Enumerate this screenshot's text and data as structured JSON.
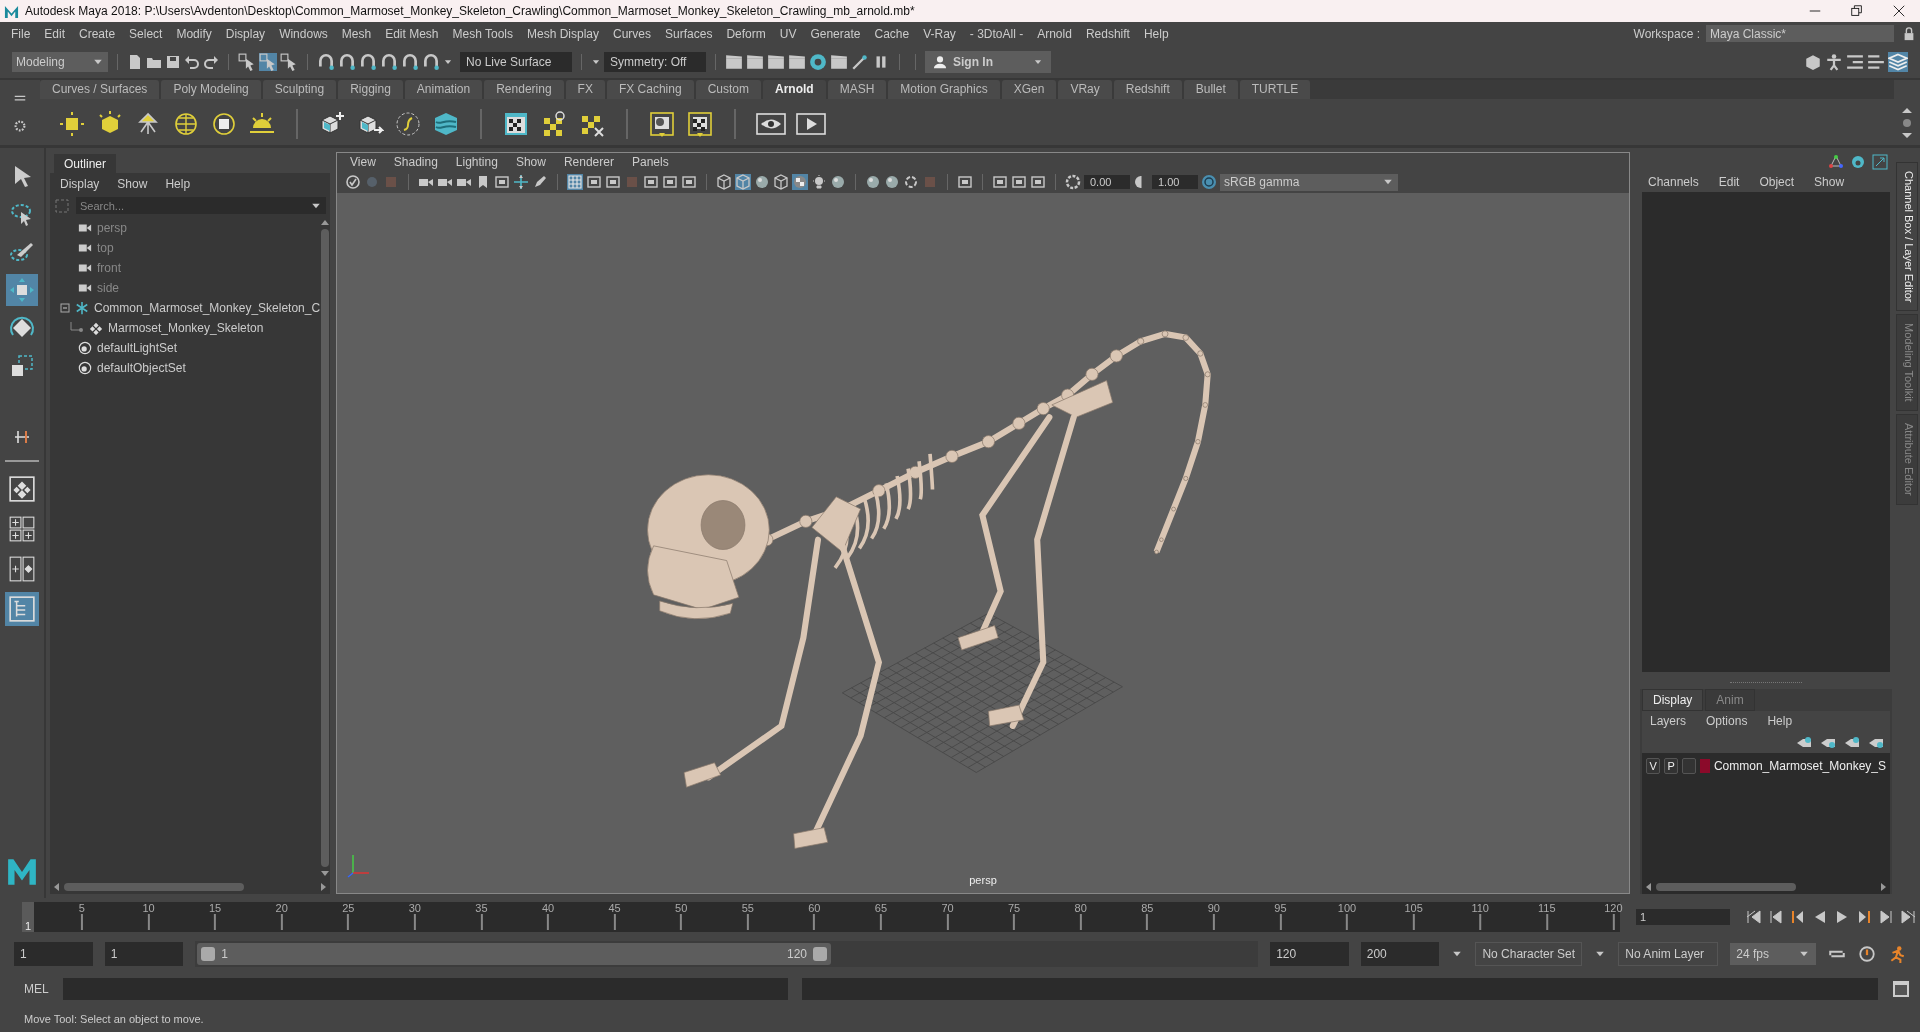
{
  "window": {
    "title": "Autodesk Maya 2018: P:\\Users\\Avdenton\\Desktop\\Common_Marmoset_Monkey_Skeleton_Crawling\\Common_Marmoset_Monkey_Skeleton_Crawling_mb_arnold.mb*"
  },
  "menu_bar": [
    "File",
    "Edit",
    "Create",
    "Select",
    "Modify",
    "Display",
    "Windows",
    "Mesh",
    "Edit Mesh",
    "Mesh Tools",
    "Mesh Display",
    "Curves",
    "Surfaces",
    "Deform",
    "UV",
    "Generate",
    "Cache",
    "V-Ray",
    "- 3DtoAll -",
    "Arnold",
    "Redshift",
    "Help"
  ],
  "workspace": {
    "label": "Workspace :",
    "value": "Maya Classic*"
  },
  "status_line": {
    "mode": "Modeling",
    "selection_masks": [
      {
        "selected": false
      },
      {
        "selected": true
      },
      {
        "selected": false
      }
    ],
    "live_surface": "No Live Surface",
    "symmetry": "Symmetry: Off",
    "sign_in": "Sign In"
  },
  "shelf_tabs": [
    {
      "label": "Curves / Surfaces",
      "selected": false
    },
    {
      "label": "Poly Modeling",
      "selected": false
    },
    {
      "label": "Sculpting",
      "selected": false
    },
    {
      "label": "Rigging",
      "selected": false
    },
    {
      "label": "Animation",
      "selected": false
    },
    {
      "label": "Rendering",
      "selected": false
    },
    {
      "label": "FX",
      "selected": false
    },
    {
      "label": "FX Caching",
      "selected": false
    },
    {
      "label": "Custom",
      "selected": false
    },
    {
      "label": "Arnold",
      "selected": true
    },
    {
      "label": "MASH",
      "selected": false
    },
    {
      "label": "Motion Graphics",
      "selected": false
    },
    {
      "label": "XGen",
      "selected": false
    },
    {
      "label": "VRay",
      "selected": false
    },
    {
      "label": "Redshift",
      "selected": false
    },
    {
      "label": "Bullet",
      "selected": false
    },
    {
      "label": "TURTLE",
      "selected": false
    }
  ],
  "toolbox": {
    "tools": [
      {
        "selected": false
      },
      {
        "selected": false
      },
      {
        "selected": false
      },
      {
        "selected": true
      },
      {
        "selected": false
      },
      {
        "selected": false
      }
    ],
    "layouts": [
      {
        "selected": false
      },
      {
        "selected": false
      },
      {
        "selected": false
      },
      {
        "selected": true
      }
    ]
  },
  "outliner": {
    "tab": "Outliner",
    "menu": [
      "Display",
      "Show",
      "Help"
    ],
    "search_placeholder": "Search...",
    "items": [
      {
        "label": "persp",
        "kind": "camera",
        "dimmed": true
      },
      {
        "label": "top",
        "kind": "camera",
        "dimmed": true
      },
      {
        "label": "front",
        "kind": "camera",
        "dimmed": true
      },
      {
        "label": "side",
        "kind": "camera",
        "dimmed": true
      },
      {
        "label": "Common_Marmoset_Monkey_Skeleton_C",
        "kind": "group",
        "dimmed": false,
        "expanded": true,
        "children": [
          {
            "label": "Marmoset_Monkey_Skeleton",
            "kind": "mesh",
            "dimmed": false
          }
        ]
      },
      {
        "label": "defaultLightSet",
        "kind": "set",
        "dimmed": false
      },
      {
        "label": "defaultObjectSet",
        "kind": "set",
        "dimmed": false
      }
    ]
  },
  "viewport": {
    "menu": [
      "View",
      "Shading",
      "Lighting",
      "Show",
      "Renderer",
      "Panels"
    ],
    "toolbar": [
      {
        "selected": false
      },
      {
        "selected": false
      },
      {
        "selected": false
      },
      {
        "selected": false
      },
      {
        "selected": false
      },
      {
        "selected": false
      },
      {
        "selected": false
      },
      {
        "selected": false
      },
      {
        "selected": false
      },
      {
        "selected": false
      },
      {
        "selected": true
      },
      {
        "selected": false
      },
      {
        "selected": false
      },
      {
        "selected": false
      },
      {
        "selected": false
      },
      {
        "selected": false
      },
      {
        "selected": false
      },
      {
        "selected": false
      },
      {
        "selected": true
      },
      {
        "selected": false
      },
      {
        "selected": false
      },
      {
        "selected": true
      },
      {
        "selected": false
      },
      {
        "selected": false
      },
      {
        "selected": false
      },
      {
        "selected": false
      },
      {
        "selected": false
      },
      {
        "selected": false
      },
      {
        "selected": false
      },
      {
        "selected": false
      },
      {
        "selected": false
      },
      {
        "selected": false
      }
    ],
    "exposure": "0.00",
    "gamma": "1.00",
    "color_space": "sRGB gamma",
    "camera_label": "persp"
  },
  "channel_box": {
    "menu": [
      "Channels",
      "Edit",
      "Object",
      "Show"
    ]
  },
  "layer_editor": {
    "tabs": [
      {
        "label": "Display",
        "selected": true
      },
      {
        "label": "Anim",
        "selected": false
      }
    ],
    "menu": [
      "Layers",
      "Options",
      "Help"
    ],
    "layers": [
      {
        "visible": "V",
        "playback": "P",
        "color": "#8b0a2a",
        "name": "Common_Marmoset_Monkey_S"
      }
    ]
  },
  "side_tabs": [
    {
      "label": "Channel Box / Layer Editor",
      "selected": true
    },
    {
      "label": "Modeling Toolkit",
      "selected": false
    },
    {
      "label": "Attribute Editor",
      "selected": false
    }
  ],
  "time_slider": {
    "ticks": [
      "5",
      "10",
      "15",
      "20",
      "25",
      "30",
      "35",
      "40",
      "45",
      "50",
      "55",
      "60",
      "65",
      "70",
      "75",
      "80",
      "85",
      "90",
      "95",
      "100",
      "105",
      "110",
      "115",
      "120"
    ],
    "current": "1",
    "level": 0,
    "current_frame": "1"
  },
  "range": {
    "start": "1",
    "playback_start": "1",
    "range_start": "1",
    "range_end": "120",
    "level": 0.6,
    "playback_end": "120",
    "end": "200",
    "character_set": "No Character Set",
    "anim_layer": "No Anim Layer",
    "fps": "24 fps"
  },
  "command_line": {
    "label": "MEL"
  },
  "help_line": "Move Tool: Select an object to move."
}
